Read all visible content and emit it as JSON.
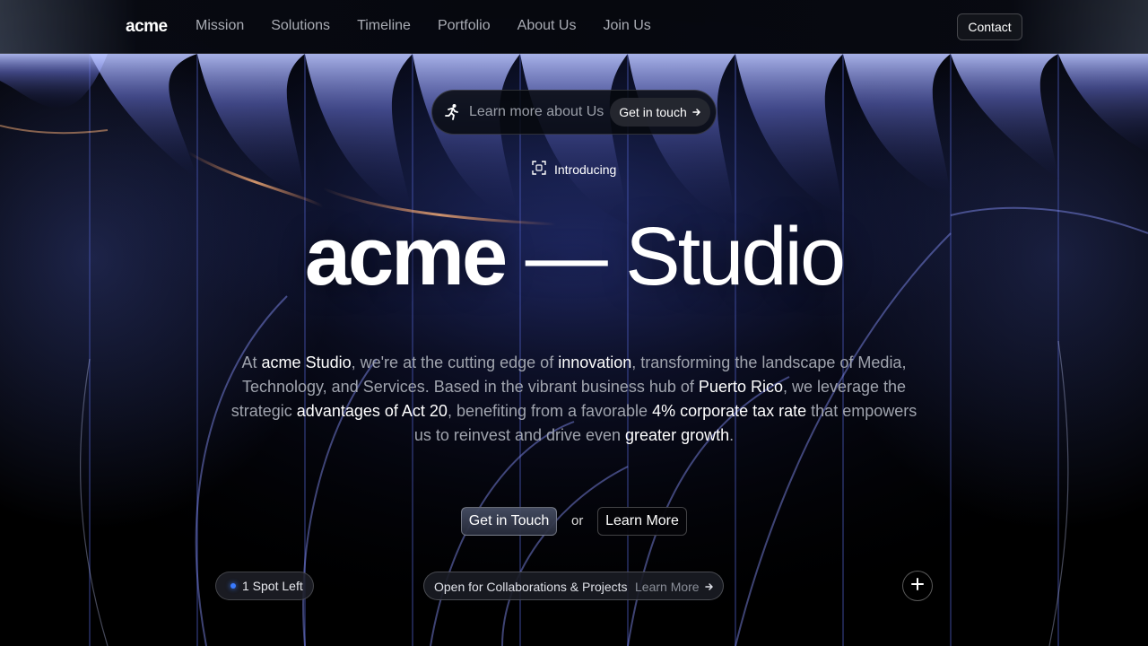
{
  "nav": {
    "logo": "acme",
    "links": [
      "Mission",
      "Solutions",
      "Timeline",
      "Portfolio",
      "About Us",
      "Join Us"
    ],
    "contact_label": "Contact"
  },
  "pill": {
    "icon": "runner-icon",
    "text": "Learn more about Us",
    "button_label": "Get in touch",
    "button_icon": "arrow-right-icon"
  },
  "intro": {
    "icon": "scan-icon",
    "label": "Introducing"
  },
  "headline": {
    "bold": "acme",
    "dash": " — ",
    "light": "Studio"
  },
  "description": {
    "p1": "At ",
    "h1": "acme Studio",
    "p2": ", we're at the cutting edge of ",
    "h2": "innovation",
    "p3": ", transforming the landscape of Media, Technology, and Services. Based in the vibrant business hub of ",
    "h3": "Puerto Rico",
    "p4": ", we leverage the strategic ",
    "h4": "advantages of Act 20",
    "p5": ", benefiting from a favorable ",
    "h5": "4% corporate tax rate",
    "p6": " that empowers us to reinvest and drive even ",
    "h6": "greater growth",
    "p7": "."
  },
  "cta": {
    "primary_label": "Get in Touch",
    "or_label": "or",
    "secondary_label": "Learn More"
  },
  "footer_bar": {
    "spot_label": "1 Spot Left",
    "spot_dot_color": "#3a7bff",
    "collab_text": "Open for Collaborations & Projects",
    "collab_link": "Learn More",
    "plus_icon": "plus-icon"
  }
}
